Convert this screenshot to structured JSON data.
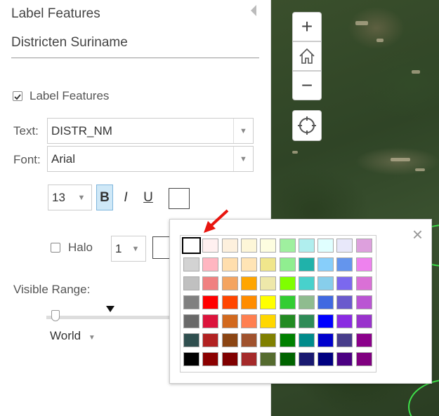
{
  "panel": {
    "title": "Label Features",
    "layer_name": "Districten Suriname",
    "label_features_checkbox": "Label Features",
    "text_label": "Text:",
    "text_value": "DISTR_NM",
    "font_label": "Font:",
    "font_value": "Arial",
    "font_size": "13",
    "bold": "B",
    "italic": "I",
    "underline": "U",
    "halo_label": "Halo",
    "halo_size": "1",
    "visible_range_label": "Visible Range:",
    "scale_value": "World"
  },
  "map_controls": {
    "zoom_in": "+",
    "zoom_out": "−"
  },
  "color_popup": {
    "close": "×",
    "rows": [
      [
        "#ffffff",
        "#fff0f0",
        "#fdf0dd",
        "#fdf6d8",
        "#fdfde0",
        "#9ff09f",
        "#b0eeee",
        "#e0ffff",
        "#e8e8fa",
        "#dda0dd"
      ],
      [
        "#d3d3d3",
        "#ffb6c1",
        "#ffdead",
        "#ffe4b5",
        "#f0e68c",
        "#90ee90",
        "#20b2aa",
        "#87cefa",
        "#6495ed",
        "#ee82ee"
      ],
      [
        "#c0c0c0",
        "#f08080",
        "#f4a460",
        "#ffa500",
        "#eee8aa",
        "#7fff00",
        "#48d1cc",
        "#87ceeb",
        "#7b68ee",
        "#da70d6"
      ],
      [
        "#808080",
        "#ff0000",
        "#ff4500",
        "#ff8c00",
        "#ffff00",
        "#32cd32",
        "#8fbc8f",
        "#4169e1",
        "#6a5acd",
        "#ba55d3"
      ],
      [
        "#696969",
        "#dc143c",
        "#d2691e",
        "#ff7f50",
        "#ffd700",
        "#228b22",
        "#2e8b57",
        "#0000ff",
        "#8a2be2",
        "#9932cc"
      ],
      [
        "#2f4f4f",
        "#b22222",
        "#8b4513",
        "#a0522d",
        "#808000",
        "#008000",
        "#008b8b",
        "#0000cd",
        "#483d8b",
        "#8b008b"
      ],
      [
        "#000000",
        "#8b0000",
        "#800000",
        "#a52a2a",
        "#556b2f",
        "#006400",
        "#191970",
        "#000080",
        "#4b0082",
        "#800080"
      ]
    ]
  }
}
